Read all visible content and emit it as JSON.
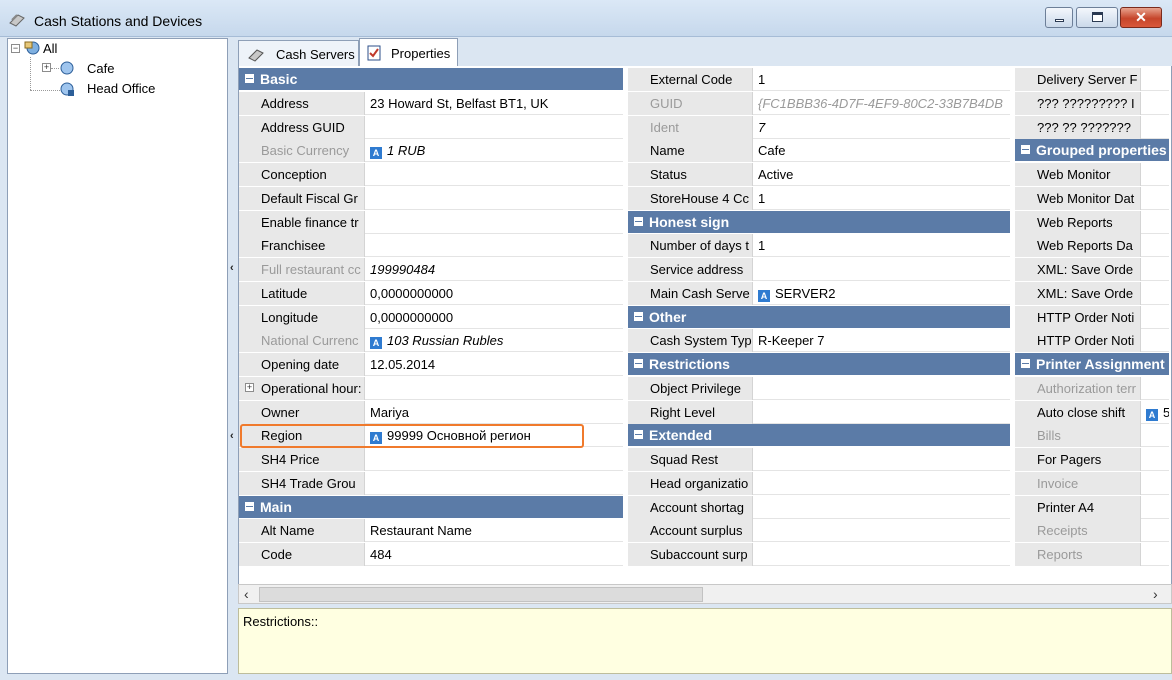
{
  "window": {
    "title": "Cash Stations and Devices"
  },
  "tree": {
    "root": "All",
    "children": [
      "Cafe",
      "Head Office"
    ]
  },
  "tabs": [
    "Cash Servers",
    "Properties"
  ],
  "columns": [
    {
      "rows": [
        {
          "hdr": "Basic"
        },
        {
          "k": "Address",
          "v": "23 Howard St, Belfast BT1, UK"
        },
        {
          "k": "Address GUID",
          "v": ""
        },
        {
          "k": "Basic Currency",
          "v": "1 RUB",
          "dis": true,
          "ital": true,
          "ref": true
        },
        {
          "k": "Conception",
          "v": ""
        },
        {
          "k": "Default Fiscal Gr",
          "v": ""
        },
        {
          "k": "Enable finance tr",
          "v": ""
        },
        {
          "k": "Franchisee",
          "v": ""
        },
        {
          "k": "Full restaurant cc",
          "v": "199990484",
          "dis": true,
          "ital": true
        },
        {
          "k": "Latitude",
          "v": "0,0000000000"
        },
        {
          "k": "Longitude",
          "v": "0,0000000000"
        },
        {
          "k": "National Currenc",
          "v": "103 Russian Rubles",
          "dis": true,
          "ital": true,
          "ref": true
        },
        {
          "k": "Opening date",
          "v": "12.05.2014"
        },
        {
          "k": "Operational hour:",
          "v": "",
          "plus": true
        },
        {
          "k": "Owner",
          "v": "Mariya"
        },
        {
          "k": "Region",
          "v": "99999 Основной регион",
          "ref": true
        },
        {
          "k": "SH4 Price",
          "v": ""
        },
        {
          "k": "SH4 Trade Grou",
          "v": ""
        },
        {
          "hdr": "Main"
        },
        {
          "k": "Alt Name",
          "v": "Restaurant Name"
        },
        {
          "k": "Code",
          "v": "484"
        }
      ]
    },
    {
      "rows": [
        {
          "k": "External Code",
          "v": "1"
        },
        {
          "k": "GUID",
          "v": "{FC1BBB36-4D7F-4EF9-80C2-33B7B4DB",
          "dis": true,
          "vdis": true
        },
        {
          "k": "Ident",
          "v": "7",
          "dis": true,
          "ital": true
        },
        {
          "k": "Name",
          "v": "Cafe"
        },
        {
          "k": "Status",
          "v": "Active"
        },
        {
          "k": "StoreHouse 4 Cc",
          "v": "1"
        },
        {
          "hdr": "Honest sign"
        },
        {
          "k": "Number of days t",
          "v": "1"
        },
        {
          "k": "Service address",
          "v": ""
        },
        {
          "k": "Main Cash Serve",
          "v": "SERVER2",
          "ref": true
        },
        {
          "hdr": "Other"
        },
        {
          "k": "Cash System Typ",
          "v": "R-Keeper 7"
        },
        {
          "hdr": "Restrictions"
        },
        {
          "k": "Object Privilege",
          "v": ""
        },
        {
          "k": "Right Level",
          "v": ""
        },
        {
          "hdr": "Extended"
        },
        {
          "k": "Squad Rest",
          "v": ""
        },
        {
          "k": "Head organizatio",
          "v": ""
        },
        {
          "k": "Account shortag",
          "v": ""
        },
        {
          "k": "Account surplus",
          "v": ""
        },
        {
          "k": "Subaccount surp",
          "v": ""
        }
      ]
    },
    {
      "rows": [
        {
          "k": "Delivery Server F",
          "v": ""
        },
        {
          "k": "??? ????????? I",
          "v": ""
        },
        {
          "k": "??? ?? ???????",
          "v": ""
        },
        {
          "hdr": "Grouped properties"
        },
        {
          "k": "Web Monitor",
          "v": ""
        },
        {
          "k": "Web Monitor Dat",
          "v": ""
        },
        {
          "k": "Web Reports",
          "v": ""
        },
        {
          "k": "Web Reports Da",
          "v": ""
        },
        {
          "k": "XML: Save Orde",
          "v": ""
        },
        {
          "k": "XML: Save Orde",
          "v": ""
        },
        {
          "k": "HTTP Order Noti",
          "v": ""
        },
        {
          "k": "HTTP Order Noti",
          "v": ""
        },
        {
          "hdr": "Printer Assignment"
        },
        {
          "k": "Authorization terr",
          "v": "",
          "dis": true
        },
        {
          "k": "Auto close shift",
          "v": "5",
          "ref": true
        },
        {
          "k": "Bills",
          "v": "",
          "dis": true
        },
        {
          "k": "For Pagers",
          "v": ""
        },
        {
          "k": "Invoice",
          "v": "",
          "dis": true
        },
        {
          "k": "Printer A4",
          "v": ""
        },
        {
          "k": "Receipts",
          "v": "",
          "dis": true
        },
        {
          "k": "Reports",
          "v": "",
          "dis": true
        }
      ]
    }
  ],
  "restrictions_label": "Restrictions::",
  "colors": {
    "header": "#5b7ba7",
    "highlight": "#f07a2c",
    "info_bg": "#ffffe1"
  }
}
